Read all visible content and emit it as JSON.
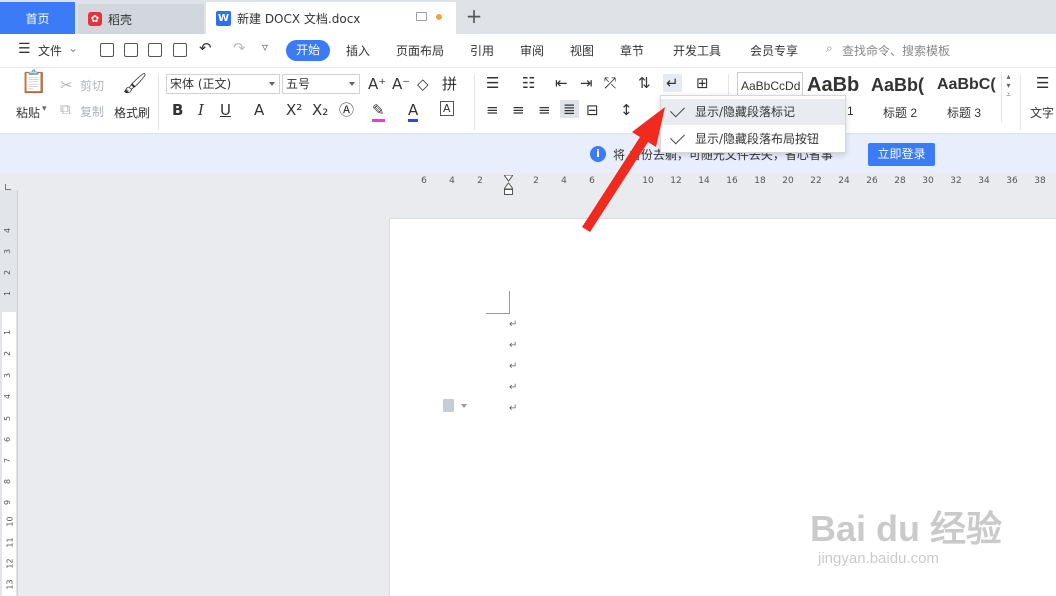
{
  "tabs": {
    "home": "首页",
    "daoke": "稻壳",
    "doc": "新建 DOCX 文档.docx",
    "daoke_icon": "daoke-logo-icon",
    "doc_icon": "wps-writer-icon"
  },
  "menu": {
    "file": "文件",
    "items": [
      "开始",
      "插入",
      "页面布局",
      "引用",
      "审阅",
      "视图",
      "章节",
      "开发工具",
      "会员专享"
    ],
    "search": "查找命令、搜索模板"
  },
  "ribbon": {
    "paste": "粘贴",
    "cut": "剪切",
    "copy": "复制",
    "format_painter": "格式刷",
    "font_name": "宋体 (正文)",
    "font_size": "五号",
    "styles": [
      {
        "sample": "AaBbCcDd",
        "name": ""
      },
      {
        "sample": "AaBb",
        "name": "1"
      },
      {
        "sample": "AaBb(",
        "name": "标题 2"
      },
      {
        "sample": "AaBbC(",
        "name": "标题 3"
      }
    ],
    "text_tools": "文字"
  },
  "dropdown": {
    "items": [
      "显示/隐藏段落标记",
      "显示/隐藏段落布局按钮"
    ]
  },
  "notice": {
    "text": "将         备份去躺，可随光文件去失，省心省事",
    "login": "立即登录"
  },
  "hruler_ticks": [
    "6",
    "4",
    "2",
    "2",
    "4",
    "6",
    "8",
    "10",
    "12",
    "14",
    "16",
    "18",
    "20",
    "22",
    "24",
    "26",
    "28",
    "30",
    "32",
    "34",
    "36",
    "38"
  ],
  "vruler_ticks": [
    "4",
    "3",
    "2",
    "1",
    "1",
    "2",
    "3",
    "4",
    "5",
    "6",
    "7",
    "8",
    "9",
    "10",
    "11",
    "12",
    "13"
  ],
  "paragraph_mark": "↵",
  "watermark": {
    "main": "Bai du 经验",
    "sub": "jingyan.baidu.com"
  },
  "colors": {
    "accent": "#3b7bf6",
    "arrow": "#f02a1f",
    "highlight": "#e8ebf0"
  }
}
